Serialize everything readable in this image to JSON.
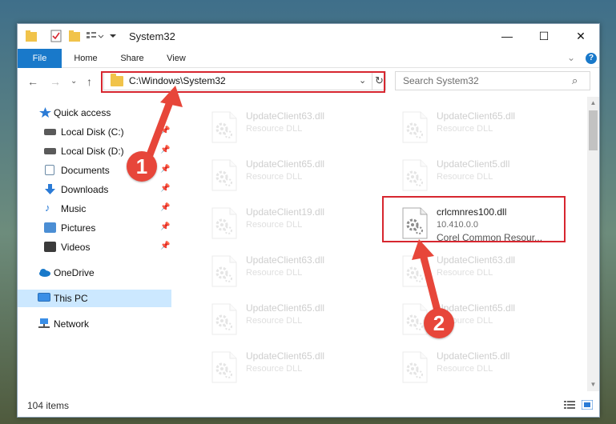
{
  "window": {
    "title": "System32",
    "controls": {
      "minimize": "—",
      "maximize": "☐",
      "close": "✕"
    }
  },
  "ribbon": {
    "tabs": [
      "File",
      "Home",
      "Share",
      "View"
    ],
    "help": "?"
  },
  "address_bar": {
    "path": "C:\\Windows\\System32",
    "refresh": "↻"
  },
  "search": {
    "placeholder": "Search System32"
  },
  "sidebar": {
    "quick_access": "Quick access",
    "items": [
      {
        "label": "Local Disk (C:)",
        "icon": "drive-icon",
        "pinned": true
      },
      {
        "label": "Local Disk (D:)",
        "icon": "drive-icon",
        "pinned": true
      },
      {
        "label": "Documents",
        "icon": "documents-icon",
        "pinned": true
      },
      {
        "label": "Downloads",
        "icon": "downloads-icon",
        "pinned": true
      },
      {
        "label": "Music",
        "icon": "music-icon",
        "pinned": true
      },
      {
        "label": "Pictures",
        "icon": "pictures-icon",
        "pinned": true
      },
      {
        "label": "Videos",
        "icon": "videos-icon",
        "pinned": true
      }
    ],
    "onedrive": "OneDrive",
    "this_pc": "This PC",
    "network": "Network"
  },
  "files": [
    {
      "name": "UpdateClient63.dll",
      "type": "Resource DLL",
      "faded": true
    },
    {
      "name": "UpdateClient65.dll",
      "type": "Resource DLL",
      "faded": true
    },
    {
      "name": "UpdateClient65.dll",
      "type": "Resource DLL",
      "faded": true
    },
    {
      "name": "UpdateClient5.dll",
      "type": "Resource DLL",
      "faded": true
    },
    {
      "name": "UpdateClient19.dll",
      "type": "Resource DLL",
      "faded": true
    },
    {
      "name": "crlcmnres100.dll",
      "version": "10.410.0.0",
      "type": "Corel Common Resour...",
      "faded": false,
      "highlighted": true
    },
    {
      "name": "UpdateClient63.dll",
      "type": "Resource DLL",
      "faded": true
    },
    {
      "name": "UpdateClient63.dll",
      "type": "Resource DLL",
      "faded": true
    },
    {
      "name": "UpdateClient65.dll",
      "type": "Resource DLL",
      "faded": true
    },
    {
      "name": "UpdateClient65.dll",
      "type": "Resource DLL",
      "faded": true
    },
    {
      "name": "UpdateClient65.dll",
      "type": "Resource DLL",
      "faded": true
    },
    {
      "name": "UpdateClient5.dll",
      "type": "Resource DLL",
      "faded": true
    }
  ],
  "status": {
    "count": "104 items"
  },
  "callouts": [
    {
      "number": "1"
    },
    {
      "number": "2"
    }
  ],
  "colors": {
    "accent": "#1979ca",
    "highlight": "#d7262f",
    "callout": "#e7463a",
    "selected": "#cce8ff"
  }
}
